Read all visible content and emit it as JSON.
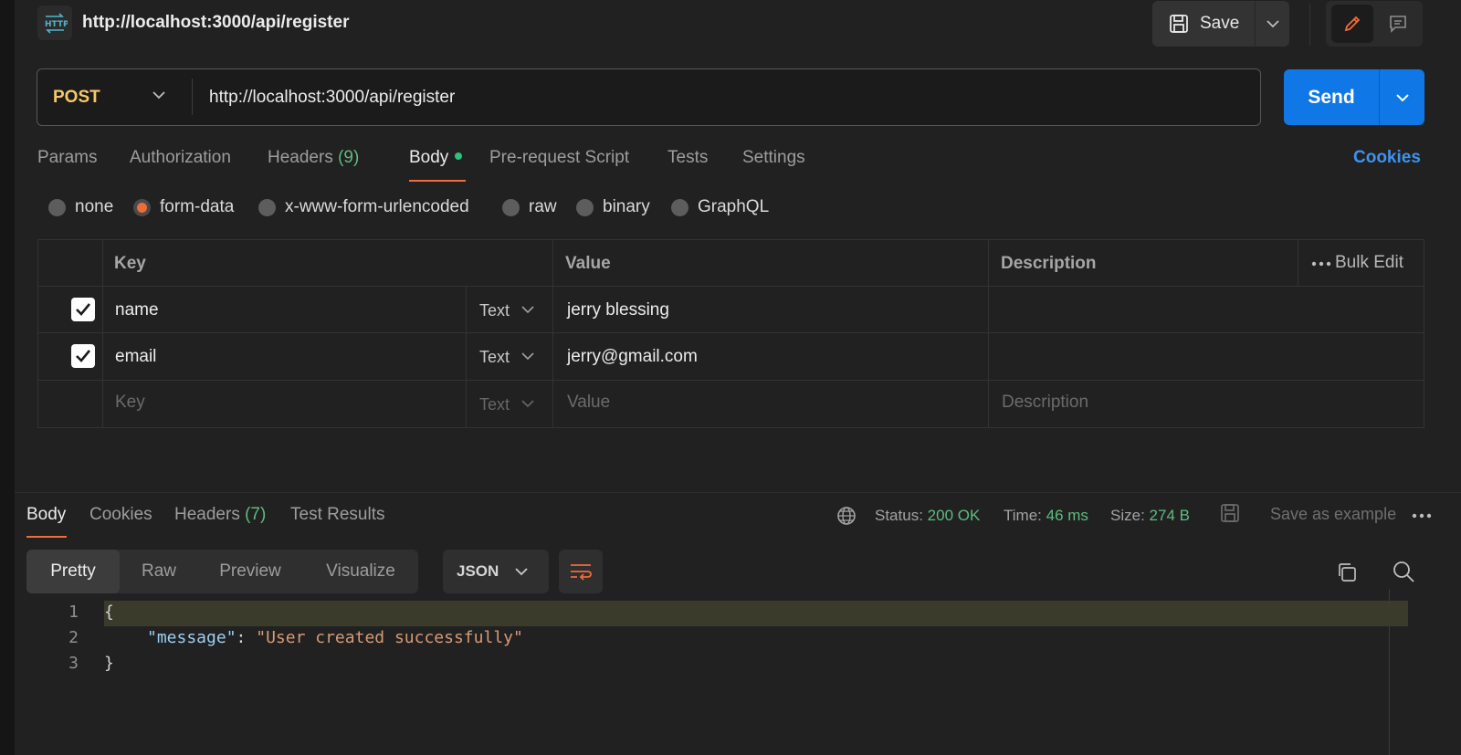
{
  "header": {
    "request_title": "http://localhost:3000/api/register",
    "save_label": "Save",
    "http_icon_text": "HTTP"
  },
  "request": {
    "method": "POST",
    "url": "http://localhost:3000/api/register",
    "send_label": "Send"
  },
  "request_tabs": [
    {
      "label": "Params"
    },
    {
      "label": "Authorization"
    },
    {
      "label": "Headers",
      "count": "(9)"
    },
    {
      "label": "Body",
      "active": true
    },
    {
      "label": "Pre-request Script"
    },
    {
      "label": "Tests"
    },
    {
      "label": "Settings"
    }
  ],
  "cookies_link": "Cookies",
  "body_types": [
    {
      "label": "none",
      "selected": false
    },
    {
      "label": "form-data",
      "selected": true
    },
    {
      "label": "x-www-form-urlencoded",
      "selected": false
    },
    {
      "label": "raw",
      "selected": false
    },
    {
      "label": "binary",
      "selected": false
    },
    {
      "label": "GraphQL",
      "selected": false
    }
  ],
  "form_table": {
    "headers": {
      "key": "Key",
      "value": "Value",
      "description": "Description",
      "bulk_edit": "Bulk Edit"
    },
    "rows": [
      {
        "checked": true,
        "key": "name",
        "type": "Text",
        "value": "jerry blessing",
        "description": ""
      },
      {
        "checked": true,
        "key": "email",
        "type": "Text",
        "value": "jerry@gmail.com",
        "description": ""
      }
    ],
    "placeholder_row": {
      "key": "Key",
      "type": "Text",
      "value": "Value",
      "description": "Description"
    }
  },
  "response": {
    "tabs": [
      {
        "label": "Body",
        "active": true
      },
      {
        "label": "Cookies"
      },
      {
        "label": "Headers",
        "count": "(7)"
      },
      {
        "label": "Test Results"
      }
    ],
    "status_label": "Status:",
    "status_value": "200 OK",
    "time_label": "Time:",
    "time_value": "46 ms",
    "size_label": "Size:",
    "size_value": "274 B",
    "save_as_example": "Save as example",
    "view_modes": [
      "Pretty",
      "Raw",
      "Preview",
      "Visualize"
    ],
    "active_view": "Pretty",
    "format": "JSON",
    "code_lines": [
      {
        "n": "1",
        "text": "{"
      },
      {
        "n": "2",
        "key": "\"message\"",
        "sep": ": ",
        "str": "\"User created successfully\""
      },
      {
        "n": "3",
        "text": "}"
      }
    ]
  },
  "colors": {
    "accent": "#ef6c38",
    "send": "#0f77e6",
    "method": "#f5c869",
    "success": "#5fbb80",
    "link": "#3d93ee"
  }
}
